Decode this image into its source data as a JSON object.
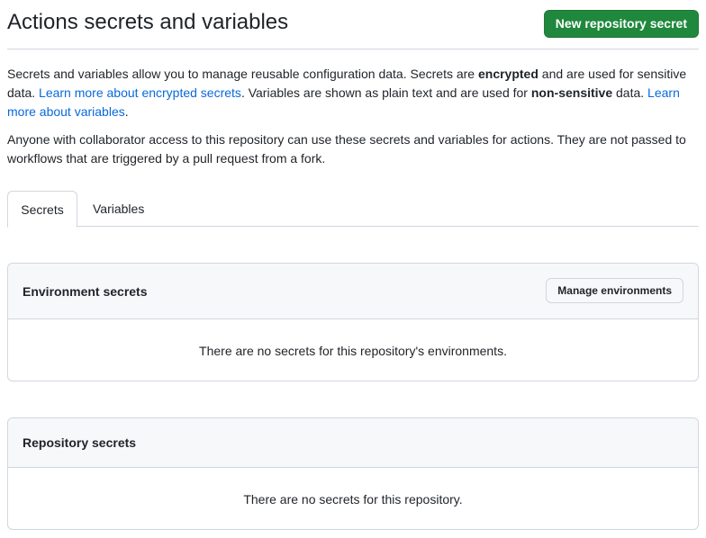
{
  "header": {
    "title": "Actions secrets and variables",
    "new_secret_button": "New repository secret"
  },
  "description": {
    "p1_part1": "Secrets and variables allow you to manage reusable configuration data. Secrets are ",
    "p1_bold1": "encrypted",
    "p1_part2": " and are used for sensitive data. ",
    "p1_link1": "Learn more about encrypted secrets",
    "p1_part3": ". Variables are shown as plain text and are used for ",
    "p1_bold2": "non-sensitive",
    "p1_part4": " data. ",
    "p1_link2": "Learn more about variables",
    "p1_part5": ".",
    "p2": "Anyone with collaborator access to this repository can use these secrets and variables for actions. They are not passed to workflows that are triggered by a pull request from a fork."
  },
  "tabs": [
    {
      "label": "Secrets",
      "selected": true
    },
    {
      "label": "Variables",
      "selected": false
    }
  ],
  "environment_secrets": {
    "title": "Environment secrets",
    "manage_button": "Manage environments",
    "empty_text": "There are no secrets for this repository's environments."
  },
  "repository_secrets": {
    "title": "Repository secrets",
    "empty_text": "There are no secrets for this repository."
  },
  "colors": {
    "primary_button": "#1f883d",
    "link": "#0969da",
    "border": "#d0d7de",
    "header_bg": "#f6f8fa"
  }
}
